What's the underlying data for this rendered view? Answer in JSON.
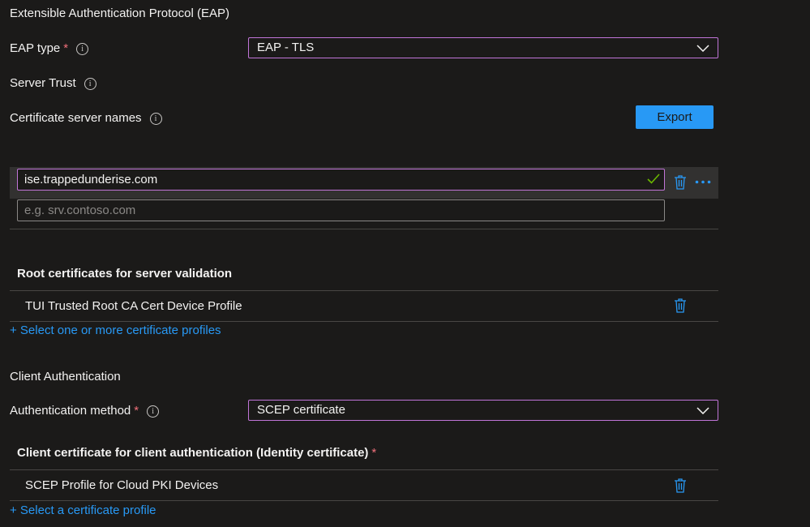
{
  "eap": {
    "title": "Extensible Authentication Protocol (EAP)",
    "eap_type_label": "EAP type",
    "eap_type_value": "EAP - TLS",
    "server_trust_label": "Server Trust",
    "cert_server_names_label": "Certificate server names",
    "export_label": "Export",
    "server_name_value": "ise.trappedunderise.com",
    "server_name_placeholder": "e.g. srv.contoso.com"
  },
  "root_certs": {
    "heading": "Root certificates for server validation",
    "items": [
      {
        "label": "TUI Trusted Root CA Cert Device Profile"
      }
    ],
    "add_link": "+ Select one or more certificate profiles"
  },
  "client_auth": {
    "title": "Client Authentication",
    "method_label": "Authentication method",
    "method_value": "SCEP certificate",
    "identity_heading": "Client certificate for client authentication (Identity certificate)",
    "items": [
      {
        "label": "SCEP Profile for Cloud PKI Devices"
      }
    ],
    "add_link": "+ Select a certificate profile"
  },
  "colors": {
    "background": "#1b1a19",
    "accent_border": "#c175d8",
    "link": "#2899f5",
    "required": "#f1707b",
    "valid_check": "#6bb700"
  },
  "icons": {
    "required": "*",
    "info": "i",
    "valid": "check-icon",
    "delete": "trash-icon",
    "more": "ellipsis-icon",
    "dropdown": "chevron-down-icon"
  }
}
